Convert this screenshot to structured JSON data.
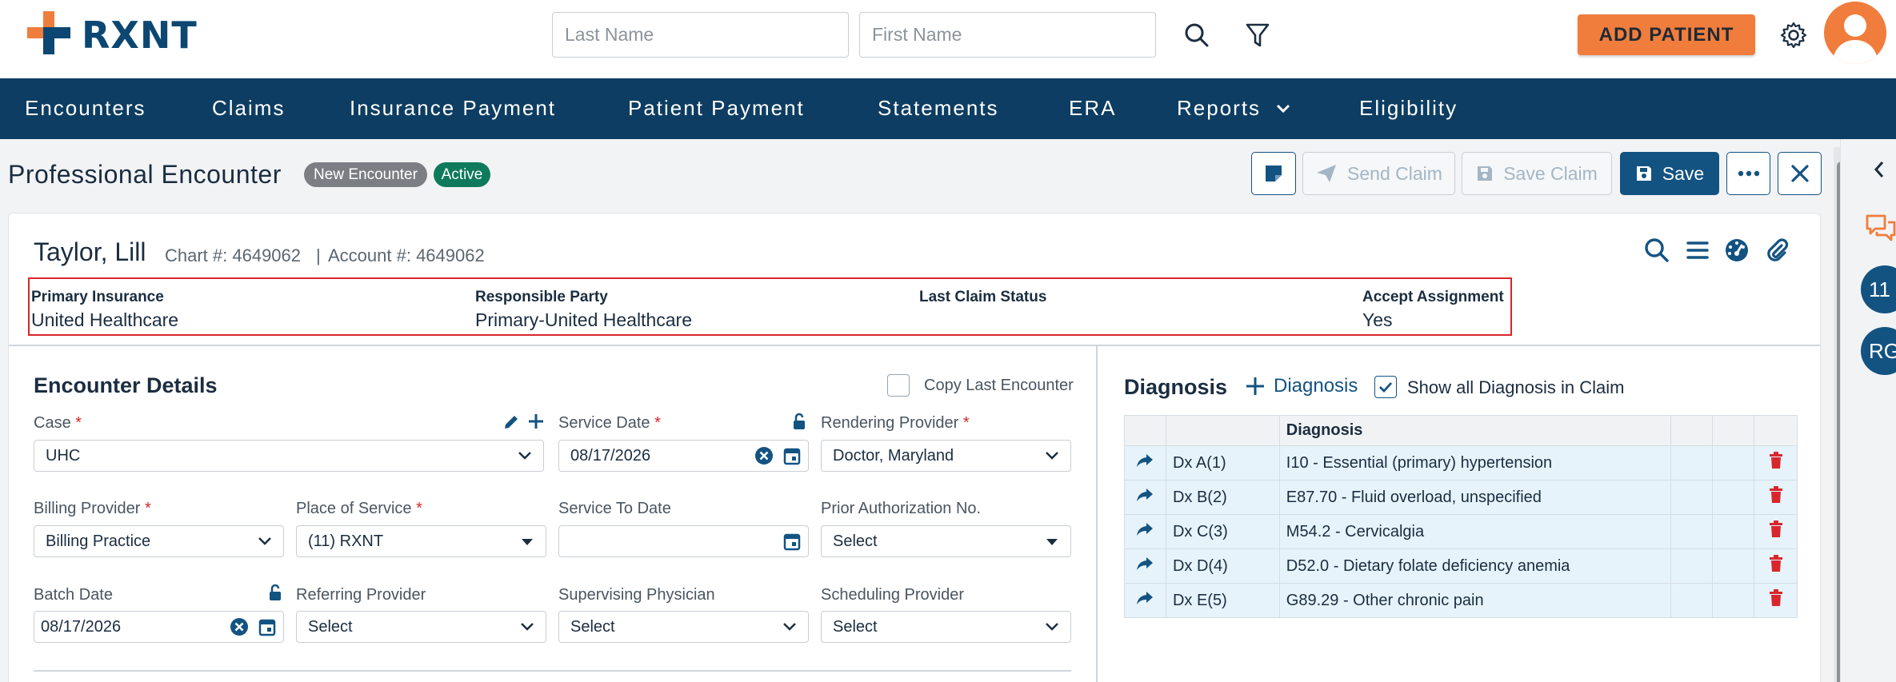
{
  "app": {
    "logo_text": "RXNT"
  },
  "search": {
    "last_name_placeholder": "Last Name",
    "first_name_placeholder": "First Name"
  },
  "header": {
    "add_patient_label": "ADD PATIENT"
  },
  "nav": {
    "items": [
      {
        "label": "Encounters"
      },
      {
        "label": "Claims"
      },
      {
        "label": "Insurance Payment"
      },
      {
        "label": "Patient Payment"
      },
      {
        "label": "Statements"
      },
      {
        "label": "ERA"
      },
      {
        "label": "Reports"
      },
      {
        "label": "Eligibility"
      }
    ]
  },
  "page": {
    "title": "Professional Encounter",
    "badges": {
      "new": "New Encounter",
      "active": "Active"
    },
    "toolbar": {
      "send_claim": "Send Claim",
      "save_claim": "Save Claim",
      "save": "Save"
    }
  },
  "patient": {
    "name": "Taylor, Lill",
    "chart": "Chart #: 4649062",
    "separator": "|",
    "account": "Account #: 4649062",
    "info": {
      "primary_insurance_label": "Primary Insurance",
      "primary_insurance_value": "United Healthcare",
      "responsible_party_label": "Responsible Party",
      "responsible_party_value": "Primary-United Healthcare",
      "last_claim_status_label": "Last Claim Status",
      "last_claim_status_value": "",
      "accept_assignment_label": "Accept Assignment",
      "accept_assignment_value": "Yes"
    }
  },
  "encounter": {
    "title": "Encounter Details",
    "copy_last_label": "Copy Last Encounter",
    "required_mark": "*",
    "case": {
      "label": "Case",
      "value": "UHC"
    },
    "service_date": {
      "label": "Service Date",
      "value": "08/17/2026"
    },
    "rendering_provider": {
      "label": "Rendering Provider",
      "value": "Doctor, Maryland"
    },
    "billing_provider": {
      "label": "Billing Provider",
      "value": "Billing Practice"
    },
    "place_of_service": {
      "label": "Place of Service",
      "value": "(11) RXNT"
    },
    "service_to_date": {
      "label": "Service To Date",
      "value": ""
    },
    "prior_auth": {
      "label": "Prior Authorization No.",
      "value": "Select"
    },
    "batch_date": {
      "label": "Batch Date",
      "value": "08/17/2026"
    },
    "referring_provider": {
      "label": "Referring Provider",
      "value": "Select"
    },
    "supervising_physician": {
      "label": "Supervising Physician",
      "value": "Select"
    },
    "scheduling_provider": {
      "label": "Scheduling Provider",
      "value": "Select"
    }
  },
  "diagnosis": {
    "title": "Diagnosis",
    "add_label": "Diagnosis",
    "show_all_label": "Show all Diagnosis in Claim",
    "show_all_checked": true,
    "column_header": "Diagnosis",
    "rows": [
      {
        "pointer": "Dx A(1)",
        "description": "I10 - Essential (primary) hypertension"
      },
      {
        "pointer": "Dx B(2)",
        "description": "E87.70 - Fluid overload, unspecified"
      },
      {
        "pointer": "Dx C(3)",
        "description": "M54.2 - Cervicalgia"
      },
      {
        "pointer": "Dx D(4)",
        "description": "D52.0 - Dietary folate deficiency anemia"
      },
      {
        "pointer": "Dx E(5)",
        "description": "G89.29 - Other chronic pain"
      }
    ]
  },
  "rail": {
    "badge_1": "11",
    "badge_2": "RG"
  },
  "colors": {
    "brand_navy": "#0d3d62",
    "brand_orange": "#f07d3c",
    "primary": "#135382",
    "badge_active": "#0e7a5c",
    "badge_new": "#7b7f84",
    "danger": "#d9262c",
    "dx_row": "#e6f3fb"
  }
}
